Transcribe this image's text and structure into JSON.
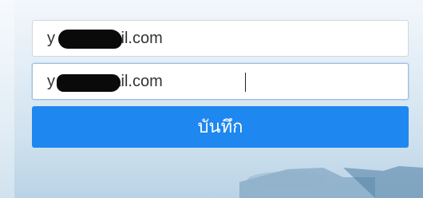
{
  "form": {
    "email_field_1": {
      "value": "y          rn@gmail.com"
    },
    "email_field_2": {
      "value": "y          rn@gmail.com"
    },
    "save_label": "บันทึก"
  },
  "colors": {
    "button": "#1e87f0",
    "redaction": "#0a0a0a"
  }
}
